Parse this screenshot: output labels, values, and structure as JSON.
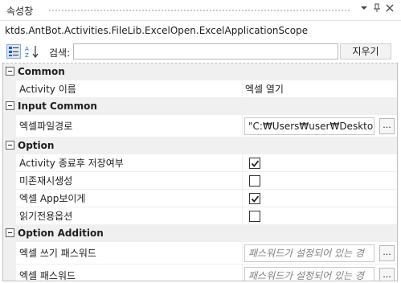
{
  "window": {
    "title": "속성창",
    "pin_glyph": "ᵩ",
    "close_glyph": "×"
  },
  "type_name": "ktds.AntBot.Activities.FileLib.ExcelOpen.ExcelApplicationScope",
  "toolbar": {
    "search_label": "검색:",
    "search_value": "",
    "clear_label": "지우기"
  },
  "categories": [
    {
      "label": "Common",
      "properties": [
        {
          "name": "Activity 이름",
          "value": "엑셀 열기"
        }
      ]
    },
    {
      "label": "Input Common",
      "properties": [
        {
          "name": "엑셀파일경로",
          "value": "\"C:₩Users₩user₩Desktop₩te",
          "ellipsis": "..."
        }
      ]
    },
    {
      "label": "Option",
      "properties": [
        {
          "name": "Activity 종료후 저장여부",
          "checked": true
        },
        {
          "name": "미존재시생성",
          "checked": false
        },
        {
          "name": "엑셀 App보이게",
          "checked": true
        },
        {
          "name": "읽기전용옵션",
          "checked": false
        }
      ]
    },
    {
      "label": "Option Addition",
      "properties": [
        {
          "name": "엑셀 쓰기 패스워드",
          "placeholder": "패스워드가 설정되어 있는 경",
          "ellipsis": "..."
        },
        {
          "name": "엑셀 패스워드",
          "placeholder": "패스워드가 설정되어 있는 경",
          "ellipsis": "..."
        }
      ]
    }
  ],
  "colors": {
    "category_bg": "#f0f0f0",
    "grid_line": "#f0f0f0",
    "sort_icon_blue": "#1f5fbf"
  }
}
